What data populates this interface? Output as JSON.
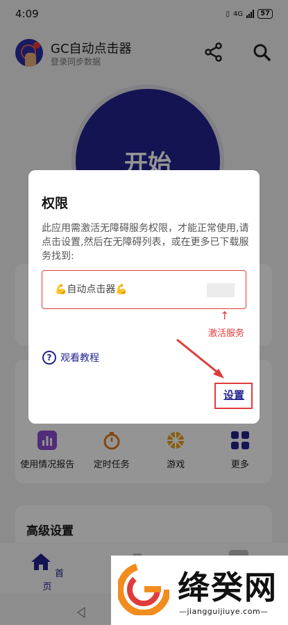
{
  "status": {
    "time": "4:09",
    "network": "4G",
    "battery": "57"
  },
  "header": {
    "title": "GC自动点击器",
    "subtitle": "登录同步数据"
  },
  "main": {
    "start_label": "开始"
  },
  "tools": [
    {
      "label": "使用情况报告",
      "icon": "bar-chart-icon"
    },
    {
      "label": "定时任务",
      "icon": "stopwatch-icon"
    },
    {
      "label": "游戏",
      "icon": "wheel-icon"
    },
    {
      "label": "更多",
      "icon": "grid-icon"
    }
  ],
  "advanced": {
    "title": "高级设置"
  },
  "bottom_nav": {
    "home_label": "首页",
    "third_icon_text": "¥"
  },
  "dialog": {
    "title": "权限",
    "body": "此应用需激活无障碍服务权限，才能正常使用,请点击设置,然后在无障碍列表，或在更多已下载服务找到:",
    "service_name": "💪自动点击器💪",
    "arrow": "↑",
    "activate_hint": "激活服务",
    "tutorial_icon": "?",
    "tutorial_label": "观看教程",
    "settings_button": "设置"
  },
  "watermark": {
    "name": "绛癸网",
    "url": "—jiangguijiuye.com—"
  },
  "colors": {
    "accent": "#23238f",
    "highlight": "#e03b3b"
  }
}
